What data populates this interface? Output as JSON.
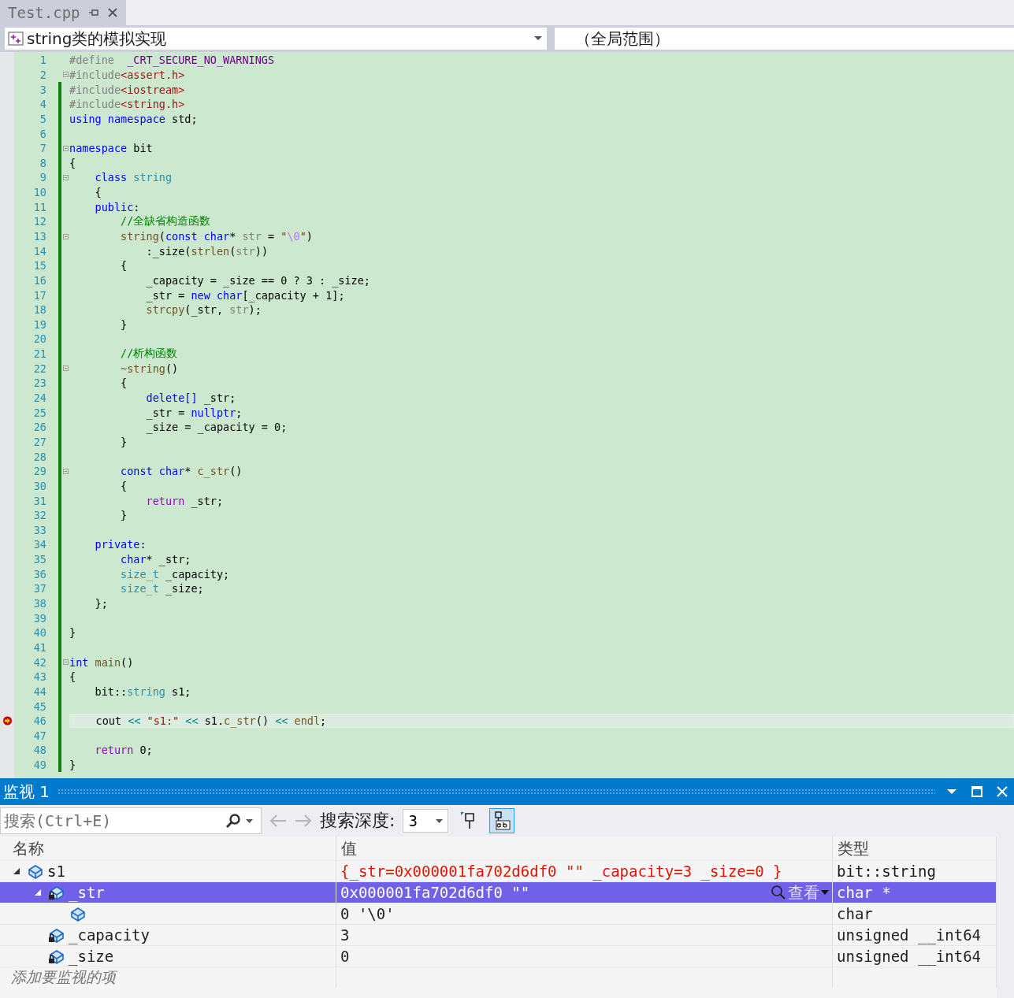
{
  "tab": {
    "title": "Test.cpp",
    "selected": true
  },
  "navigation": {
    "scope": "string类的模拟实现",
    "member": "（全局范围）"
  },
  "code_lines": [
    {
      "n": "1",
      "fold": false,
      "current": false,
      "changed": false,
      "segs": [
        {
          "t": "#define  ",
          "kind": "preproc"
        },
        {
          "t": "_CRT_SECURE_NO_WARNINGS",
          "kind": "macro"
        }
      ]
    },
    {
      "n": "2",
      "fold": true,
      "current": false,
      "changed": false,
      "segs": [
        {
          "t": "#include",
          "kind": "preproc"
        },
        {
          "t": "<assert.h>",
          "kind": "string"
        }
      ]
    },
    {
      "n": "3",
      "fold": false,
      "current": false,
      "changed": true,
      "segs": [
        {
          "t": "#include",
          "kind": "preproc"
        },
        {
          "t": "<iostream>",
          "kind": "string"
        }
      ]
    },
    {
      "n": "4",
      "fold": false,
      "current": false,
      "changed": true,
      "segs": [
        {
          "t": "#include",
          "kind": "preproc"
        },
        {
          "t": "<string.h>",
          "kind": "string"
        }
      ]
    },
    {
      "n": "5",
      "fold": false,
      "current": false,
      "changed": true,
      "segs": [
        {
          "t": "using namespace",
          "kind": "keyword"
        },
        {
          "t": " std;",
          "kind": "plain"
        }
      ]
    },
    {
      "n": "6",
      "fold": false,
      "current": false,
      "changed": true
    },
    {
      "n": "7",
      "fold": true,
      "current": false,
      "changed": true,
      "segs": [
        {
          "t": "namespace",
          "kind": "keyword"
        },
        {
          "t": " bit",
          "kind": "plain"
        }
      ]
    },
    {
      "n": "8",
      "fold": false,
      "current": false,
      "changed": true,
      "segs": [
        {
          "t": "{",
          "kind": "plain"
        }
      ]
    },
    {
      "n": "9",
      "fold": true,
      "current": false,
      "changed": true,
      "segs": [
        {
          "t": "    class ",
          "kind": "keyword"
        },
        {
          "t": "string",
          "kind": "type"
        }
      ]
    },
    {
      "n": "10",
      "fold": false,
      "current": false,
      "changed": true,
      "segs": [
        {
          "t": "    {",
          "kind": "plain"
        }
      ]
    },
    {
      "n": "11",
      "fold": false,
      "current": false,
      "changed": true,
      "segs": [
        {
          "t": "    public",
          "kind": "keyword"
        },
        {
          "t": ":",
          "kind": "plain"
        }
      ]
    },
    {
      "n": "12",
      "fold": false,
      "current": false,
      "changed": true,
      "segs": [
        {
          "t": "        //全缺省构造函数",
          "kind": "comment"
        }
      ]
    },
    {
      "n": "13",
      "fold": true,
      "current": false,
      "changed": true,
      "segs": [
        {
          "t": "        string",
          "kind": "func"
        },
        {
          "t": "(",
          "kind": "plain"
        },
        {
          "t": "const char",
          "kind": "keyword"
        },
        {
          "t": "* ",
          "kind": "plain"
        },
        {
          "t": "str",
          "kind": "param"
        },
        {
          "t": " = ",
          "kind": "plain"
        },
        {
          "t": "\"",
          "kind": "string"
        },
        {
          "t": "\\0",
          "kind": "escape"
        },
        {
          "t": "\"",
          "kind": "string"
        },
        {
          "t": ")",
          "kind": "plain"
        }
      ]
    },
    {
      "n": "14",
      "fold": false,
      "current": false,
      "changed": true,
      "segs": [
        {
          "t": "            :_size(",
          "kind": "plain"
        },
        {
          "t": "strlen",
          "kind": "func"
        },
        {
          "t": "(",
          "kind": "plain"
        },
        {
          "t": "str",
          "kind": "param"
        },
        {
          "t": "))",
          "kind": "plain"
        }
      ]
    },
    {
      "n": "15",
      "fold": false,
      "current": false,
      "changed": true,
      "segs": [
        {
          "t": "        {",
          "kind": "plain"
        }
      ]
    },
    {
      "n": "16",
      "fold": false,
      "current": false,
      "changed": true,
      "segs": [
        {
          "t": "            _capacity = _size == 0 ? 3 : _size;",
          "kind": "plain"
        }
      ]
    },
    {
      "n": "17",
      "fold": false,
      "current": false,
      "changed": true,
      "segs": [
        {
          "t": "            _str = ",
          "kind": "plain"
        },
        {
          "t": "new char",
          "kind": "keyword"
        },
        {
          "t": "[_capacity + 1];",
          "kind": "plain"
        }
      ]
    },
    {
      "n": "18",
      "fold": false,
      "current": false,
      "changed": true,
      "segs": [
        {
          "t": "            strcpy",
          "kind": "func"
        },
        {
          "t": "(_str, ",
          "kind": "plain"
        },
        {
          "t": "str",
          "kind": "param"
        },
        {
          "t": ");",
          "kind": "plain"
        }
      ]
    },
    {
      "n": "19",
      "fold": false,
      "current": false,
      "changed": true,
      "segs": [
        {
          "t": "        }",
          "kind": "plain"
        }
      ]
    },
    {
      "n": "20",
      "fold": false,
      "current": false,
      "changed": true
    },
    {
      "n": "21",
      "fold": false,
      "current": false,
      "changed": true,
      "segs": [
        {
          "t": "        //析构函数",
          "kind": "comment"
        }
      ]
    },
    {
      "n": "22",
      "fold": true,
      "current": false,
      "changed": true,
      "segs": [
        {
          "t": "        ~string",
          "kind": "func"
        },
        {
          "t": "()",
          "kind": "plain"
        }
      ]
    },
    {
      "n": "23",
      "fold": false,
      "current": false,
      "changed": true,
      "segs": [
        {
          "t": "        {",
          "kind": "plain"
        }
      ]
    },
    {
      "n": "24",
      "fold": false,
      "current": false,
      "changed": true,
      "segs": [
        {
          "t": "            delete[]",
          "kind": "keyword"
        },
        {
          "t": " _str;",
          "kind": "plain"
        }
      ]
    },
    {
      "n": "25",
      "fold": false,
      "current": false,
      "changed": true,
      "segs": [
        {
          "t": "            _str = ",
          "kind": "plain"
        },
        {
          "t": "nullptr",
          "kind": "keyword"
        },
        {
          "t": ";",
          "kind": "plain"
        }
      ]
    },
    {
      "n": "26",
      "fold": false,
      "current": false,
      "changed": true,
      "segs": [
        {
          "t": "            _size = _capacity = 0;",
          "kind": "plain"
        }
      ]
    },
    {
      "n": "27",
      "fold": false,
      "current": false,
      "changed": true,
      "segs": [
        {
          "t": "        }",
          "kind": "plain"
        }
      ]
    },
    {
      "n": "28",
      "fold": false,
      "current": false,
      "changed": true
    },
    {
      "n": "29",
      "fold": true,
      "current": false,
      "changed": true,
      "segs": [
        {
          "t": "        const char",
          "kind": "keyword"
        },
        {
          "t": "* ",
          "kind": "plain"
        },
        {
          "t": "c_str",
          "kind": "func"
        },
        {
          "t": "()",
          "kind": "plain"
        }
      ]
    },
    {
      "n": "30",
      "fold": false,
      "current": false,
      "changed": true,
      "segs": [
        {
          "t": "        {",
          "kind": "plain"
        }
      ]
    },
    {
      "n": "31",
      "fold": false,
      "current": false,
      "changed": true,
      "segs": [
        {
          "t": "            return",
          "kind": "control"
        },
        {
          "t": " _str;",
          "kind": "plain"
        }
      ]
    },
    {
      "n": "32",
      "fold": false,
      "current": false,
      "changed": true,
      "segs": [
        {
          "t": "        }",
          "kind": "plain"
        }
      ]
    },
    {
      "n": "33",
      "fold": false,
      "current": false,
      "changed": true
    },
    {
      "n": "34",
      "fold": false,
      "current": false,
      "changed": true,
      "segs": [
        {
          "t": "    private",
          "kind": "keyword"
        },
        {
          "t": ":",
          "kind": "plain"
        }
      ]
    },
    {
      "n": "35",
      "fold": false,
      "current": false,
      "changed": true,
      "segs": [
        {
          "t": "        char",
          "kind": "keyword"
        },
        {
          "t": "* _str;",
          "kind": "plain"
        }
      ]
    },
    {
      "n": "36",
      "fold": false,
      "current": false,
      "changed": true,
      "segs": [
        {
          "t": "        size_t",
          "kind": "type"
        },
        {
          "t": " _capacity;",
          "kind": "plain"
        }
      ]
    },
    {
      "n": "37",
      "fold": false,
      "current": false,
      "changed": true,
      "segs": [
        {
          "t": "        size_t",
          "kind": "type"
        },
        {
          "t": " _size;",
          "kind": "plain"
        }
      ]
    },
    {
      "n": "38",
      "fold": false,
      "current": false,
      "changed": true,
      "segs": [
        {
          "t": "    };",
          "kind": "plain"
        }
      ]
    },
    {
      "n": "39",
      "fold": false,
      "current": false,
      "changed": true
    },
    {
      "n": "40",
      "fold": false,
      "current": false,
      "changed": true,
      "segs": [
        {
          "t": "}",
          "kind": "plain"
        }
      ]
    },
    {
      "n": "41",
      "fold": false,
      "current": false,
      "changed": true
    },
    {
      "n": "42",
      "fold": true,
      "current": false,
      "changed": true,
      "segs": [
        {
          "t": "int",
          "kind": "keyword"
        },
        {
          "t": " main",
          "kind": "func"
        },
        {
          "t": "()",
          "kind": "plain"
        }
      ]
    },
    {
      "n": "43",
      "fold": false,
      "current": false,
      "changed": true,
      "segs": [
        {
          "t": "{",
          "kind": "plain"
        }
      ]
    },
    {
      "n": "44",
      "fold": false,
      "current": false,
      "changed": true,
      "segs": [
        {
          "t": "    bit::",
          "kind": "plain"
        },
        {
          "t": "string",
          "kind": "type"
        },
        {
          "t": " s1;",
          "kind": "plain"
        }
      ]
    },
    {
      "n": "45",
      "fold": false,
      "current": false,
      "changed": true
    },
    {
      "n": "46",
      "fold": false,
      "current": true,
      "changed": true,
      "segs": [
        {
          "t": "    cout ",
          "kind": "plain"
        },
        {
          "t": "<<",
          "kind": "operator"
        },
        {
          "t": " \"s1:\"",
          "kind": "string"
        },
        {
          "t": " <<",
          "kind": "operator"
        },
        {
          "t": " s1.",
          "kind": "plain"
        },
        {
          "t": "c_str",
          "kind": "func"
        },
        {
          "t": "() ",
          "kind": "plain"
        },
        {
          "t": "<<",
          "kind": "operator"
        },
        {
          "t": " endl",
          "kind": "func"
        },
        {
          "t": ";",
          "kind": "plain"
        }
      ]
    },
    {
      "n": "47",
      "fold": false,
      "current": false,
      "changed": true
    },
    {
      "n": "48",
      "fold": false,
      "current": false,
      "changed": true,
      "segs": [
        {
          "t": "    return",
          "kind": "control"
        },
        {
          "t": " 0;",
          "kind": "plain"
        }
      ]
    },
    {
      "n": "49",
      "fold": false,
      "current": false,
      "changed": true,
      "segs": [
        {
          "t": "}",
          "kind": "plain"
        }
      ]
    }
  ],
  "watch": {
    "title": "监视 1",
    "search": {
      "placeholder": "搜索(Ctrl+E)"
    },
    "depth_label": "搜索深度:",
    "depth": "3",
    "pin_selected": false,
    "format_selected": true,
    "columns": [
      "名称",
      "值",
      "类型"
    ],
    "rows": [
      {
        "name": "s1",
        "value": "{_str=0x000001fa702d6df0 \"\" _capacity=3 _size=0 }",
        "type": "bit::string",
        "locked": false,
        "expanded": true,
        "selected": false,
        "changed": true,
        "children": [
          {
            "name": "_str",
            "value": "0x000001fa702d6df0 \"\"",
            "type": "char *",
            "locked": true,
            "expanded": true,
            "selected": true,
            "changed": false,
            "visualizer": "查看",
            "children": [
              {
                "value": "0 '\\0'",
                "type": "char",
                "locked": false,
                "selected": false,
                "changed": false
              }
            ]
          },
          {
            "name": "_capacity",
            "value": "3",
            "type": "unsigned __int64",
            "locked": true,
            "selected": false,
            "changed": false
          },
          {
            "name": "_size",
            "value": "0",
            "type": "unsigned __int64",
            "locked": true,
            "selected": false,
            "changed": false
          }
        ]
      }
    ],
    "add_placeholder": "添加要监视的项"
  }
}
